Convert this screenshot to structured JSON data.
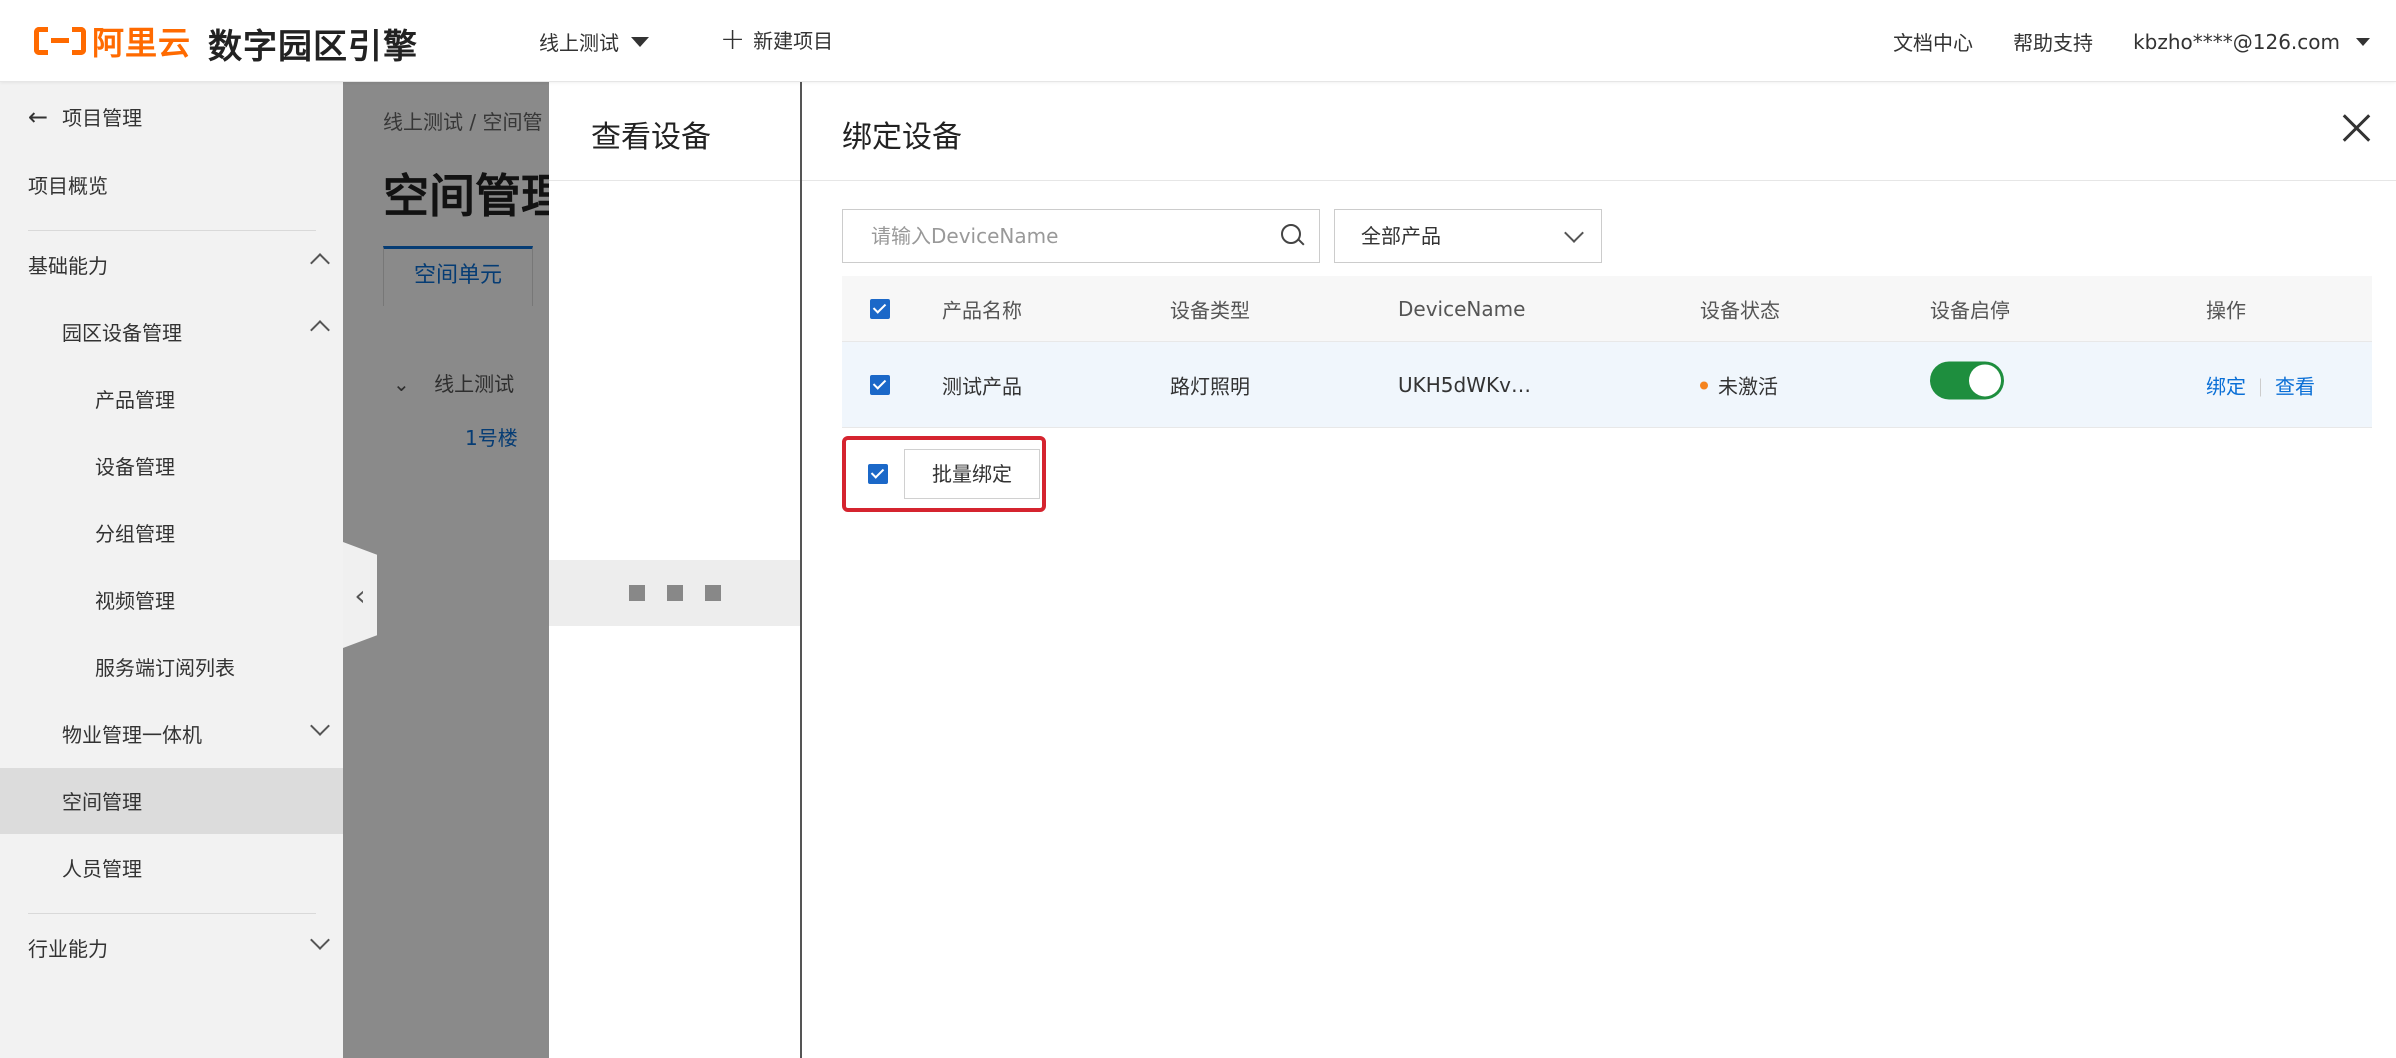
{
  "header": {
    "logo_text": "阿里云",
    "app_title": "数字园区引擎",
    "env_select": "线上测试",
    "new_project": "新建项目",
    "docs": "文档中心",
    "help": "帮助支持",
    "user": "kbzho****@126.com"
  },
  "sidebar": {
    "back_label": "项目管理",
    "overview": "项目概览",
    "basic": "基础能力",
    "park_device": "园区设备管理",
    "product_mgmt": "产品管理",
    "device_mgmt": "设备管理",
    "group_mgmt": "分组管理",
    "video_mgmt": "视频管理",
    "server_sub": "服务端订阅列表",
    "property": "物业管理一体机",
    "space": "空间管理",
    "people": "人员管理",
    "industry": "行业能力"
  },
  "background": {
    "breadcrumb": "线上测试  /  空间管",
    "title": "空间管理",
    "tab": "空间单元",
    "tree_root": "线上测试",
    "tree_child": "1号楼"
  },
  "drawer_view": {
    "title": "查看设备"
  },
  "drawer_bind": {
    "title": "绑定设备",
    "search_placeholder": "请输入DeviceName",
    "product_filter": "全部产品",
    "columns": [
      "产品名称",
      "设备类型",
      "DeviceName",
      "设备状态",
      "设备启停",
      "操作"
    ],
    "rows": [
      {
        "product": "测试产品",
        "type": "路灯照明",
        "device_name": "UKH5dWKv…",
        "status": "未激活",
        "status_color": "#f5841f",
        "enabled": true,
        "action_bind": "绑定",
        "action_view": "查看"
      }
    ],
    "batch_bind": "批量绑定"
  }
}
